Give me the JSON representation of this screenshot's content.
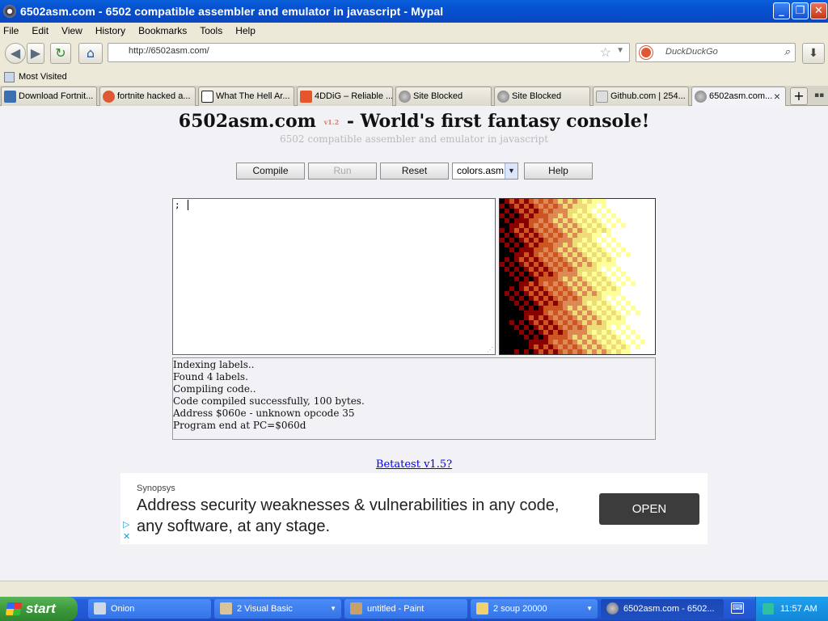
{
  "window": {
    "title": "6502asm.com - 6502 compatible assembler and emulator in javascript - Mypal",
    "minimize": "_",
    "maximize": "❐",
    "close": "✕"
  },
  "menu": [
    "File",
    "Edit",
    "View",
    "History",
    "Bookmarks",
    "Tools",
    "Help"
  ],
  "nav": {
    "back": "◀",
    "forward": "▶",
    "reload": "↻",
    "home": "⌂",
    "url": "http://6502asm.com/",
    "search_placeholder": "DuckDuckGo",
    "download": "⬇"
  },
  "bookmarks": {
    "most_visited": "Most Visited"
  },
  "tabs": [
    {
      "label": "Download Fortnit...",
      "icon_color": "#3a6fb0"
    },
    {
      "label": "fortnite hacked a...",
      "icon_color": "#de5833"
    },
    {
      "label": "What The Hell Ar...",
      "icon_color": "#222222"
    },
    {
      "label": "4DDiG – Reliable ...",
      "icon_color": "#e8552d"
    },
    {
      "label": "Site Blocked",
      "icon_color": "#888888"
    },
    {
      "label": "Site Blocked",
      "icon_color": "#888888"
    },
    {
      "label": "Github.com | 254...",
      "icon_color": "#999999"
    },
    {
      "label": "6502asm.com...",
      "icon_color": "#888888"
    }
  ],
  "page": {
    "title_main": "6502asm.com",
    "version": "v1.2",
    "title_rest": "- World's first fantasy console!",
    "subtitle": "6502 compatible assembler and emulator in javascript",
    "buttons": {
      "compile": "Compile",
      "run": "Run",
      "reset": "Reset",
      "help": "Help"
    },
    "file_select": "colors.asm",
    "code": "; ",
    "messages": [
      "Indexing labels..",
      "Found 4 labels.",
      "Compiling code..",
      "Code compiled successfully, 100 bytes.",
      "Address $060e - unknown opcode 35",
      "Program end at PC=$060d"
    ],
    "betatest_link": "Betatest v1.5?",
    "screen_palette": [
      "#000000",
      "#880000",
      "#cc5522",
      "#dd8855",
      "#eedd77",
      "#ffff99",
      "#ffffff"
    ]
  },
  "ad": {
    "brand": "Synopsys",
    "headline": "Address security weaknesses & vulnerabilities in any code, any software, at any stage.",
    "cta": "OPEN",
    "play_icon": "▷",
    "close_icon": "✕"
  },
  "taskbar": {
    "start": "start",
    "tasks": [
      {
        "label": "Onion",
        "icon_color": "#cfd8e6"
      },
      {
        "label": "2 Visual Basic",
        "icon_color": "#d9c49a"
      },
      {
        "label": "untitled - Paint",
        "icon_color": "#caa06a"
      },
      {
        "label": "2 soup 20000",
        "icon_color": "#f0d070"
      },
      {
        "label": "6502asm.com - 6502...",
        "icon_color": "#8899aa"
      }
    ],
    "clock": "11:57 AM"
  }
}
